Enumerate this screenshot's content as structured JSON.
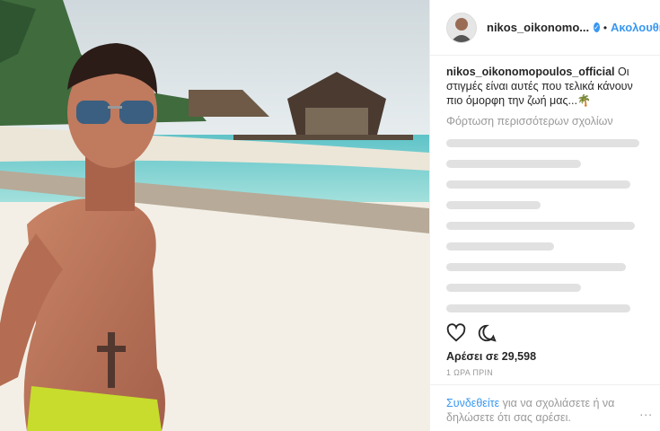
{
  "post": {
    "username_short": "nikos_oikonomo...",
    "follow_label": "Ακολουθήστε",
    "caption_user": "nikos_oikonomopoulos_official",
    "caption_text": "Οι στιγμές είναι αυτές που τελικά κάνουν πιο όμορφη την ζωή μας...🌴",
    "load_more": "Φόρτωση περισσότερων σχολίων",
    "likes": "Αρέσει σε 29,598",
    "time": "1 ΩΡΑ ΠΡΙΝ",
    "footer_link": "Συνδεθείτε",
    "footer_text": "για να σχολιάσετε ή να δηλώσετε ότι σας αρέσει.",
    "more_icon": "..."
  },
  "icons": {
    "heart": "heart-icon",
    "comment": "comment-icon",
    "verified": "verified-icon"
  },
  "colors": {
    "link": "#3897f0",
    "muted": "#999999"
  }
}
